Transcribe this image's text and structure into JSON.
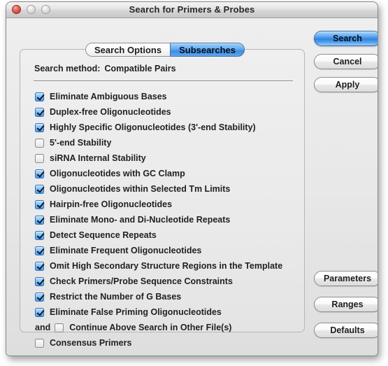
{
  "window": {
    "title": "Search for Primers & Probes",
    "traffic_lights": [
      {
        "name": "close",
        "active": true
      },
      {
        "name": "minimize",
        "active": false
      },
      {
        "name": "zoom",
        "active": false
      }
    ]
  },
  "tabs": [
    {
      "label": "Search Options",
      "selected": false
    },
    {
      "label": "Subsearches",
      "selected": true
    }
  ],
  "panel": {
    "method_label": "Search method:",
    "method_value": "Compatible Pairs",
    "options": [
      {
        "label": "Eliminate Ambiguous Bases",
        "checked": true,
        "prefix": ""
      },
      {
        "label": "Duplex-free Oligonucleotides",
        "checked": true,
        "prefix": ""
      },
      {
        "label": "Highly Specific Oligonucleotides (3'-end Stability)",
        "checked": true,
        "prefix": ""
      },
      {
        "label": "5'-end Stability",
        "checked": false,
        "prefix": ""
      },
      {
        "label": "siRNA Internal Stability",
        "checked": false,
        "prefix": ""
      },
      {
        "label": "Oligonucleotides with GC Clamp",
        "checked": true,
        "prefix": ""
      },
      {
        "label": "Oligonucleotides within Selected Tm Limits",
        "checked": true,
        "prefix": ""
      },
      {
        "label": "Hairpin-free Oligonucleotides",
        "checked": true,
        "prefix": ""
      },
      {
        "label": "Eliminate Mono- and Di-Nucleotide Repeats",
        "checked": true,
        "prefix": ""
      },
      {
        "label": "Detect Sequence Repeats",
        "checked": true,
        "prefix": ""
      },
      {
        "label": "Eliminate Frequent Oligonucleotides",
        "checked": true,
        "prefix": ""
      },
      {
        "label": "Omit High Secondary Structure Regions in the Template",
        "checked": true,
        "prefix": ""
      },
      {
        "label": "Check Primers/Probe Sequence Constraints",
        "checked": true,
        "prefix": ""
      },
      {
        "label": "Restrict the Number of G Bases",
        "checked": true,
        "prefix": ""
      },
      {
        "label": "Eliminate False Priming Oligonucleotides",
        "checked": true,
        "prefix": ""
      },
      {
        "label": "Continue Above Search in Other File(s)",
        "checked": false,
        "prefix": "and"
      },
      {
        "label": "Consensus Primers",
        "checked": false,
        "prefix": ""
      }
    ]
  },
  "buttons": {
    "search": "Search",
    "cancel": "Cancel",
    "apply": "Apply",
    "parameters": "Parameters",
    "ranges": "Ranges",
    "defaults": "Defaults"
  },
  "colors": {
    "accent_blue": "#3d8ee4",
    "window_bg": "#e8e8e8",
    "text": "#1d2024"
  }
}
